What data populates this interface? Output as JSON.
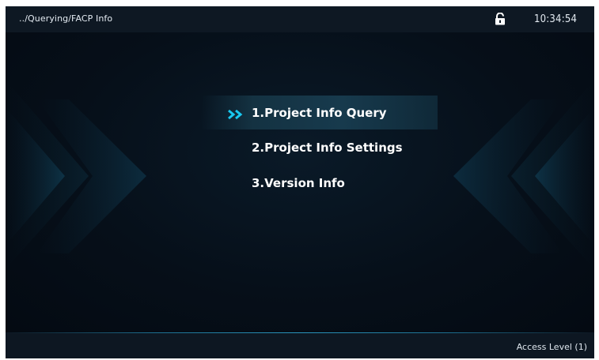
{
  "header": {
    "breadcrumb": "../Querying/FACP Info",
    "time": "10:34:54",
    "lock_state": "unlocked"
  },
  "menu": {
    "items": [
      {
        "label": "1.Project Info Query",
        "selected": true
      },
      {
        "label": "2.Project Info Settings",
        "selected": false
      },
      {
        "label": "3.Version Info",
        "selected": false
      }
    ]
  },
  "footer": {
    "access_level": "Access Level (1)"
  },
  "colors": {
    "accent": "#19c8f0",
    "background": "#050c14"
  }
}
